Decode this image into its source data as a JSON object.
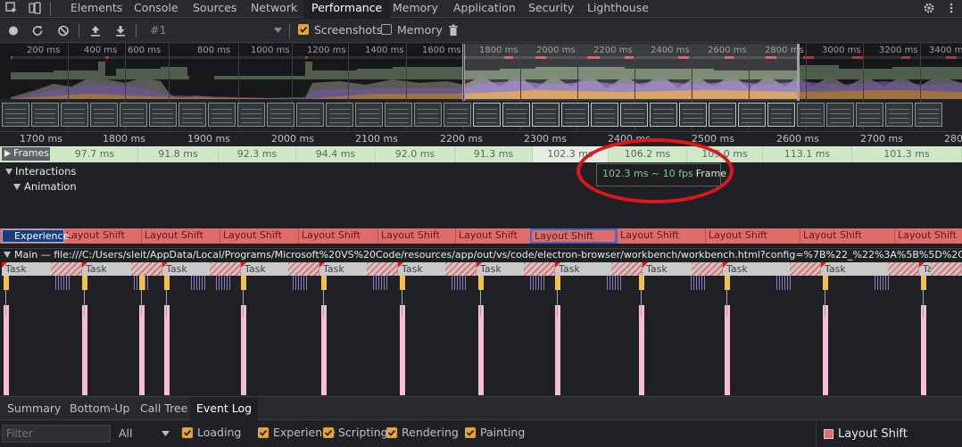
{
  "tabs": {
    "elements": "Elements",
    "console": "Console",
    "sources": "Sources",
    "network": "Network",
    "performance": "Performance",
    "memory": "Memory",
    "application": "Application",
    "security": "Security",
    "lighthouse": "Lighthouse"
  },
  "toolbar": {
    "profile_select": "#1",
    "screenshots_label": "Screenshots",
    "memory_label": "Memory",
    "screenshots_checked": true,
    "memory_checked": false
  },
  "overview": {
    "ticks": [
      "200 ms",
      "400 ms",
      "600 ms",
      "800 ms",
      "1000 ms",
      "1200 ms",
      "1400 ms",
      "1600 ms",
      "1800 ms",
      "2000 ms",
      "2200 ms",
      "2400 ms",
      "2600 ms",
      "2800 ms",
      "3000 ms",
      "3200 ms",
      "3400 ms"
    ]
  },
  "ruler": {
    "ticks": [
      "1700 ms",
      "1800 ms",
      "1900 ms",
      "2000 ms",
      "2100 ms",
      "2200 ms",
      "2300 ms",
      "2400 ms",
      "2500 ms",
      "2600 ms",
      "2700 ms",
      "2800"
    ]
  },
  "frames": {
    "label": "Frames",
    "values": [
      "97.7 ms",
      "91.8 ms",
      "92.3 ms",
      "94.4 ms",
      "92.0 ms",
      "91.3 ms",
      "102.3 ms",
      "106.2 ms",
      "109.0 ms",
      "113.1 ms",
      "101.3 ms"
    ]
  },
  "interactions": {
    "label": "Interactions",
    "animation_label": "Animation"
  },
  "tooltip": {
    "fps_text": "102.3 ms ~ 10 fps",
    "kind": "Frame"
  },
  "experience": {
    "label": "Experience",
    "items": [
      "Layout Shift",
      "Layout Shift",
      "Layout Shift",
      "Layout Shift",
      "Layout Shift",
      "Layout Shift",
      "Layout Shift",
      "Layout Shift",
      "Layout Shift",
      "Layout Shift",
      "Layout Shift"
    ]
  },
  "main": {
    "title": "Main — file:///C:/Users/sleit/AppData/Local/Programs/Microsoft%20VS%20Code/resources/app/out/vs/code/electron-browser/workbench/workbench.html?config=%7B%22_%22%3A%5B%5D%2C%22crash-reporter-id%",
    "task_label": "Task"
  },
  "bottom_tabs": {
    "summary": "Summary",
    "bottom_up": "Bottom-Up",
    "call_tree": "Call Tree",
    "event_log": "Event Log"
  },
  "filter": {
    "placeholder": "Filter",
    "duration_select": "All",
    "categories": [
      "Loading",
      "Experience",
      "Scripting",
      "Rendering",
      "Painting"
    ]
  },
  "details": {
    "title": "Layout Shift",
    "color": "#e06b6b"
  },
  "colors": {
    "accent": "#e8a23a",
    "frame_green": "#cfe8c7",
    "layout_shift": "#e06b6b",
    "tooltip_fps": "#81c995",
    "annotation_circle": "#e0161d"
  }
}
